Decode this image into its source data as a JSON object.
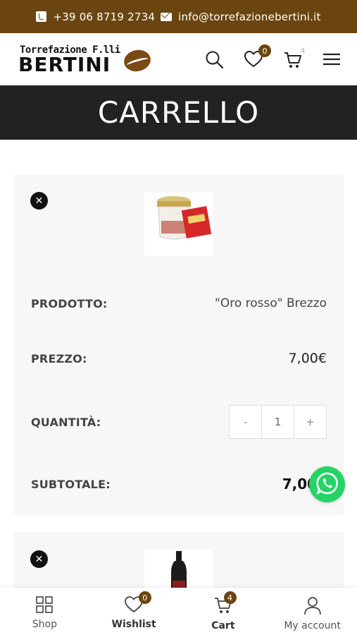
{
  "topbar": {
    "phone": "+39 06 8719 2734",
    "email": "info@torrefazionebertini.it",
    "background": "#6b4510"
  },
  "header": {
    "logo_line1": "Torrefazione F.lli",
    "logo_line2": "BERTINI",
    "wishlist_count": "0",
    "cart_count": "4",
    "icons": [
      "search-icon",
      "heart-icon",
      "cart-icon",
      "hamburger-menu-icon"
    ]
  },
  "page": {
    "title": "CARRELLO"
  },
  "cart": {
    "items": [
      {
        "product_label": "PRODOTTO:",
        "product_name": "\"Oro rosso\" Brezzo",
        "price_label": "PREZZO:",
        "price": "7,00€",
        "quantity_label": "QUANTITÀ:",
        "quantity": "1",
        "minus": "-",
        "plus": "+",
        "subtotal_label": "SUBTOTALE:",
        "subtotal": "7,00€"
      }
    ]
  },
  "bottom_nav": {
    "shop": "Shop",
    "wishlist": "Wishlist",
    "wishlist_count": "0",
    "cart": "Cart",
    "cart_count": "4",
    "account": "My account"
  },
  "colors": {
    "brand": "#6b4510",
    "title_bar": "#222222",
    "whatsapp": "#25d366"
  }
}
